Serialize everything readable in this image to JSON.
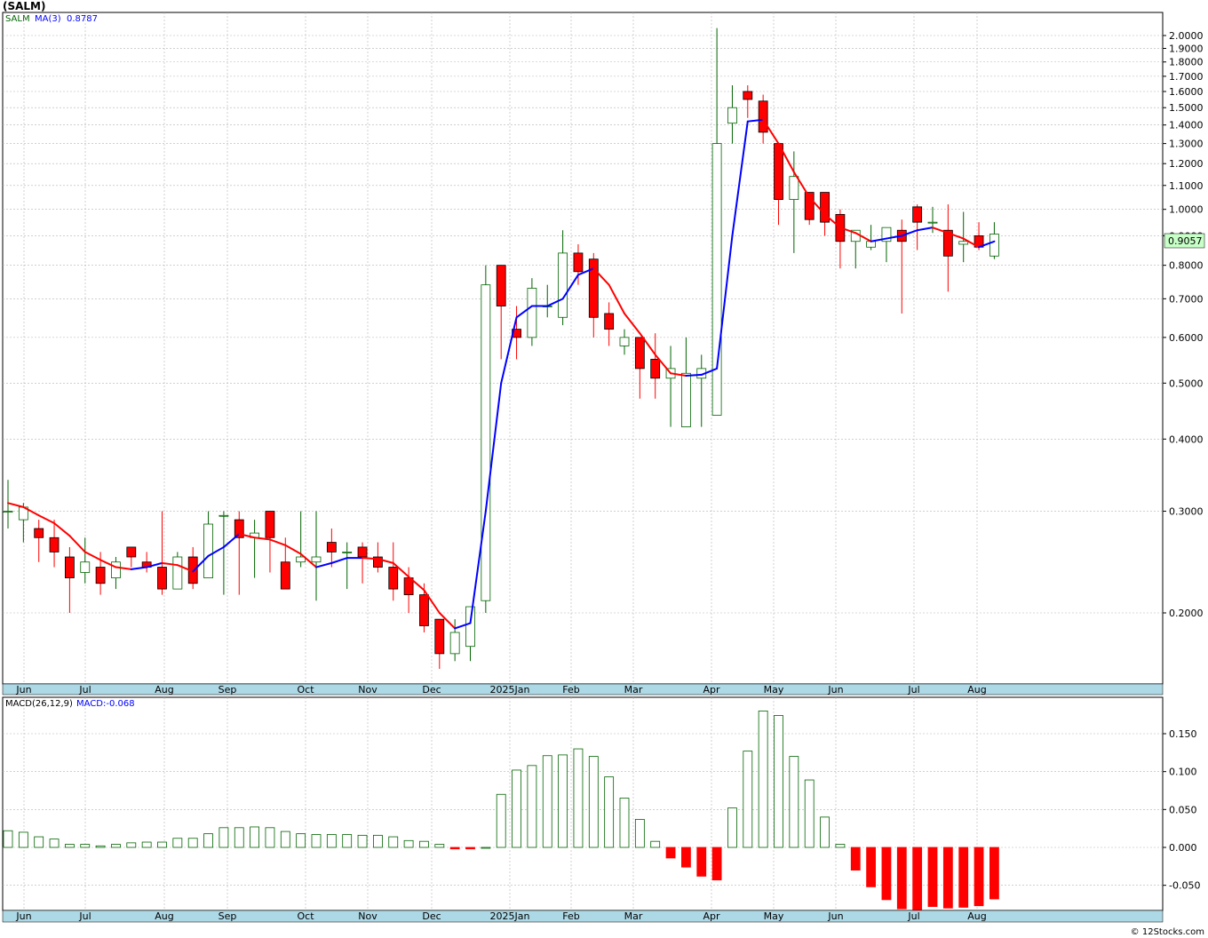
{
  "symbol": "(SALM)",
  "price_legend": {
    "ticker": "SALM",
    "ma_label": "MA(3)",
    "ma_value": "0.8787"
  },
  "last_price": "0.9057",
  "macd_legend": {
    "label": "MACD(26,12,9)",
    "value_label": "MACD:-0.068"
  },
  "watermark": "© 12Stocks.com",
  "colors": {
    "up": "#006400",
    "down": "#ff0000",
    "ma_up": "#0000ff",
    "ma_down": "#ff0000",
    "axis_band": "#add8e6",
    "grid": "#b4b4b4",
    "last_price_bg": "#c8ffc8"
  },
  "month_labels": [
    "Jun",
    "Jul",
    "Aug",
    "Sep",
    "Oct",
    "Nov",
    "Dec",
    "2025Jan",
    "Feb",
    "Mar",
    "Apr",
    "May",
    "Jun",
    "Jul",
    "Aug"
  ],
  "chart_data": [
    {
      "type": "candlestick",
      "name": "price",
      "y_scale": "log",
      "ylim": [
        0.17,
        2.2
      ],
      "y_ticks": [
        "2.0000",
        "1.9000",
        "1.8000",
        "1.7000",
        "1.6000",
        "1.5000",
        "1.4000",
        "1.3000",
        "1.2000",
        "1.1000",
        "1.0000",
        "0.9000",
        "0.8000",
        "0.7000",
        "0.6000",
        "0.5000",
        "0.4000",
        "0.3000",
        "0.2000"
      ],
      "candles": [
        [
          0.3,
          0.34,
          0.28,
          0.3
        ],
        [
          0.29,
          0.31,
          0.265,
          0.305
        ],
        [
          0.28,
          0.29,
          0.245,
          0.27
        ],
        [
          0.27,
          0.29,
          0.24,
          0.255
        ],
        [
          0.25,
          0.26,
          0.2,
          0.23
        ],
        [
          0.235,
          0.27,
          0.225,
          0.245
        ],
        [
          0.24,
          0.255,
          0.215,
          0.225
        ],
        [
          0.23,
          0.25,
          0.22,
          0.245
        ],
        [
          0.26,
          0.26,
          0.24,
          0.25
        ],
        [
          0.245,
          0.255,
          0.235,
          0.24
        ],
        [
          0.24,
          0.3,
          0.215,
          0.22
        ],
        [
          0.22,
          0.255,
          0.22,
          0.25
        ],
        [
          0.25,
          0.26,
          0.22,
          0.225
        ],
        [
          0.23,
          0.3,
          0.23,
          0.285
        ],
        [
          0.295,
          0.3,
          0.215,
          0.295
        ],
        [
          0.29,
          0.3,
          0.215,
          0.27
        ],
        [
          0.27,
          0.29,
          0.23,
          0.275
        ],
        [
          0.3,
          0.3,
          0.235,
          0.27
        ],
        [
          0.245,
          0.27,
          0.22,
          0.22
        ],
        [
          0.245,
          0.3,
          0.24,
          0.25
        ],
        [
          0.245,
          0.3,
          0.21,
          0.25
        ],
        [
          0.265,
          0.28,
          0.24,
          0.255
        ],
        [
          0.255,
          0.265,
          0.22,
          0.255
        ],
        [
          0.26,
          0.265,
          0.225,
          0.25
        ],
        [
          0.25,
          0.265,
          0.235,
          0.24
        ],
        [
          0.24,
          0.265,
          0.21,
          0.22
        ],
        [
          0.23,
          0.24,
          0.2,
          0.215
        ],
        [
          0.215,
          0.225,
          0.185,
          0.19
        ],
        [
          0.195,
          0.195,
          0.16,
          0.17
        ],
        [
          0.17,
          0.195,
          0.165,
          0.185
        ],
        [
          0.175,
          0.205,
          0.165,
          0.205
        ],
        [
          0.21,
          0.8,
          0.2,
          0.74
        ],
        [
          0.8,
          0.8,
          0.55,
          0.68
        ],
        [
          0.62,
          0.68,
          0.55,
          0.6
        ],
        [
          0.6,
          0.76,
          0.58,
          0.73
        ],
        [
          0.68,
          0.74,
          0.65,
          0.68
        ],
        [
          0.65,
          0.92,
          0.63,
          0.84
        ],
        [
          0.84,
          0.87,
          0.74,
          0.78
        ],
        [
          0.82,
          0.84,
          0.6,
          0.65
        ],
        [
          0.66,
          0.69,
          0.58,
          0.62
        ],
        [
          0.58,
          0.62,
          0.56,
          0.6
        ],
        [
          0.6,
          0.6,
          0.47,
          0.53
        ],
        [
          0.55,
          0.61,
          0.47,
          0.51
        ],
        [
          0.51,
          0.58,
          0.42,
          0.53
        ],
        [
          0.42,
          0.6,
          0.42,
          0.52
        ],
        [
          0.51,
          0.56,
          0.42,
          0.53
        ],
        [
          0.44,
          2.06,
          0.44,
          1.3
        ],
        [
          1.41,
          1.64,
          1.3,
          1.5
        ],
        [
          1.6,
          1.64,
          1.44,
          1.55
        ],
        [
          1.54,
          1.58,
          1.3,
          1.36
        ],
        [
          1.3,
          1.3,
          0.94,
          1.04
        ],
        [
          1.04,
          1.26,
          0.84,
          1.14
        ],
        [
          1.07,
          1.07,
          0.94,
          0.96
        ],
        [
          1.07,
          1.07,
          0.9,
          0.95
        ],
        [
          0.98,
          1.0,
          0.79,
          0.88
        ],
        [
          0.88,
          0.92,
          0.79,
          0.92
        ],
        [
          0.86,
          0.94,
          0.85,
          0.88
        ],
        [
          0.88,
          0.9,
          0.81,
          0.93
        ],
        [
          0.92,
          0.96,
          0.66,
          0.88
        ],
        [
          1.01,
          1.02,
          0.85,
          0.95
        ],
        [
          0.95,
          1.01,
          0.91,
          0.95
        ],
        [
          0.92,
          1.02,
          0.72,
          0.83
        ],
        [
          0.87,
          0.99,
          0.81,
          0.88
        ],
        [
          0.9,
          0.95,
          0.85,
          0.86
        ],
        [
          0.83,
          0.95,
          0.82,
          0.906
        ]
      ],
      "ma3": [
        0.31,
        0.305,
        0.295,
        0.286,
        0.272,
        0.255,
        0.247,
        0.24,
        0.238,
        0.24,
        0.244,
        0.242,
        0.236,
        0.251,
        0.26,
        0.274,
        0.27,
        0.268,
        0.262,
        0.253,
        0.24,
        0.244,
        0.249,
        0.249,
        0.248,
        0.244,
        0.231,
        0.219,
        0.2,
        0.188,
        0.192,
        0.3,
        0.5,
        0.65,
        0.68,
        0.68,
        0.7,
        0.77,
        0.79,
        0.74,
        0.66,
        0.61,
        0.56,
        0.52,
        0.515,
        0.517,
        0.53,
        0.9,
        1.42,
        1.43,
        1.3,
        1.16,
        1.05,
        0.98,
        0.93,
        0.91,
        0.88,
        0.89,
        0.9,
        0.92,
        0.93,
        0.91,
        0.89,
        0.86,
        0.88
      ]
    },
    {
      "type": "bar",
      "name": "MACD",
      "ylim": [
        -0.085,
        0.195
      ],
      "y_ticks": [
        "0.150",
        "0.100",
        "0.050",
        "0.000",
        "-0.050"
      ],
      "values": [
        0.022,
        0.02,
        0.014,
        0.011,
        0.004,
        0.004,
        0.002,
        0.004,
        0.006,
        0.007,
        0.007,
        0.012,
        0.012,
        0.018,
        0.026,
        0.026,
        0.027,
        0.026,
        0.021,
        0.018,
        0.017,
        0.017,
        0.017,
        0.016,
        0.016,
        0.014,
        0.009,
        0.008,
        0.004,
        -0.002,
        -0.002,
        0.0,
        0.07,
        0.102,
        0.108,
        0.121,
        0.122,
        0.13,
        0.12,
        0.093,
        0.065,
        0.037,
        0.008,
        -0.014,
        -0.026,
        -0.038,
        -0.043,
        0.052,
        0.127,
        0.18,
        0.174,
        0.12,
        0.089,
        0.04,
        0.004,
        -0.03,
        -0.052,
        -0.069,
        -0.081,
        -0.083,
        -0.078,
        -0.08,
        -0.079,
        -0.077,
        -0.068
      ]
    }
  ]
}
